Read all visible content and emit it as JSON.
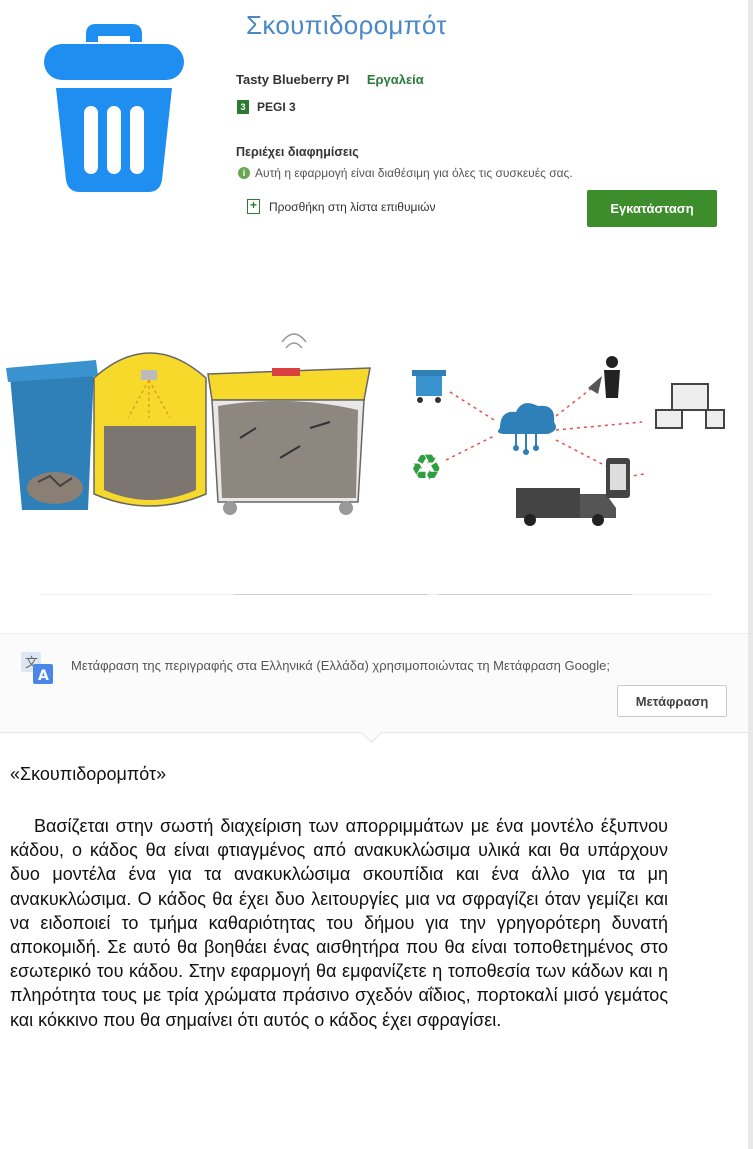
{
  "app": {
    "title": "Σκουπιδορομπότ",
    "developer": "Tasty Blueberry PI",
    "category": "Εργαλεία",
    "rating_label": "PEGI 3",
    "ads_notice": "Περιέχει διαφημίσεις",
    "availability": "Αυτή η εφαρμογή είναι διαθέσιμη για όλες τις συσκευές σας.",
    "wishlist_label": "Προσθήκη στη λίστα επιθυμιών",
    "install_label": "Εγκατάσταση",
    "icon": "trash-bin-icon",
    "accent_color": "#3d8d2c",
    "icon_color": "#1e8ff0"
  },
  "translate": {
    "prompt": "Μετάφραση της περιγραφής στα Ελληνικά (Ελλάδα) χρησιμοποιώντας τη Μετάφραση Google;",
    "button_label": "Μετάφραση",
    "icon": "google-translate-icon"
  },
  "description": {
    "title": "«Σκουπιδορομπότ»",
    "body": "Βασίζεται στην σωστή διαχείριση των απορριμμάτων με ένα μοντέλο  έξυπνου κάδου, ο κάδος θα είναι φτιαγμένος από ανακυκλώσιμα υλικά και θα υπάρχουν δυο μοντέλα ένα για τα ανακυκλώσιμα σκουπίδια και ένα άλλο για τα μη ανακυκλώσιμα. Ο κάδος θα έχει δυο λειτουργίες μια να σφραγίζει όταν γεμίζει και να ειδοποιεί το τμήμα καθαριότητας του δήμου για την γρηγορότερη δυνατή αποκομιδή. Σε αυτό θα βοηθάει ένας αισθητήρα που θα είναι τοποθετημένος στο εσωτερικό του κάδου. Στην εφαρμογή θα εμφανίζετε η τοποθεσία των κάδων και η πληρότητα τους με τρία χρώματα πράσινο σχεδόν αΐδιος, πορτοκαλί μισό γεμάτος και κόκκινο που θα σημαίνει ότι αυτός ο κάδος έχει σφραγίσει."
  }
}
